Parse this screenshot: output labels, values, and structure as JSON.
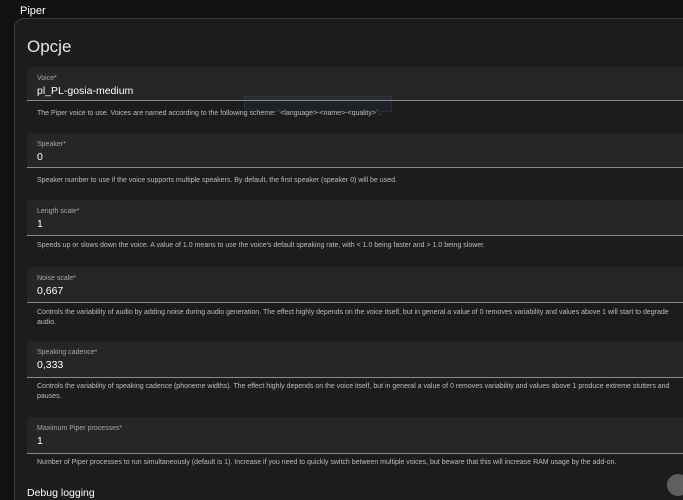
{
  "app": {
    "title": "Piper"
  },
  "card": {
    "title": "Opcje"
  },
  "fields": {
    "voice": {
      "label": "Voice*",
      "value": "pl_PL-gosia-medium",
      "helper": "The Piper voice to use. Voices are named according to the following scheme: `<language>-<name>-<quality>`."
    },
    "speaker": {
      "label": "Speaker*",
      "value": "0",
      "helper": "Speaker number to use if the voice supports multiple speakers. By default, the first speaker (speaker 0) will be used."
    },
    "length_scale": {
      "label": "Length scale*",
      "value": "1",
      "helper": "Speeds up or slows down the voice. A value of 1.0 means to use the voice's default speaking rate, with < 1.0 being faster and > 1.0 being slower."
    },
    "noise_scale": {
      "label": "Noise scale*",
      "value": "0,667",
      "helper": "Controls the variability of audio by adding noise during audio generation. The effect highly depends on the voice itself, but in general a value of 0 removes variability and values above 1 will start to degrade audio."
    },
    "speaking_cadence": {
      "label": "Speaking cadence*",
      "value": "0,333",
      "helper": "Controls the variability of speaking cadence (phoneme widths). The effect highly depends on the voice itself, but in general a value of 0 removes variability and values above 1 produce extreme stutters and pauses."
    },
    "max_processes": {
      "label": "Maximum Piper processes*",
      "value": "1",
      "helper": "Number of Piper processes to run simultaneously (default is 1). Increase if you need to quickly switch between multiple voices, but beware that this will increase RAM usage by the add-on."
    }
  },
  "debug": {
    "label": "Debug logging",
    "enabled": false
  },
  "icons": {
    "dropdown": "chevron-down-icon",
    "toggle": "toggle-switch"
  }
}
